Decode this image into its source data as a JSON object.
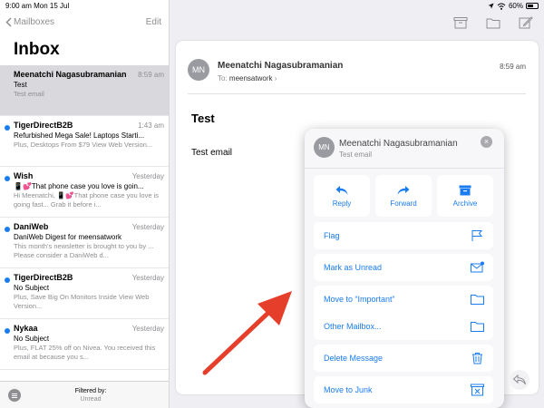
{
  "status": {
    "time_date": "9:00 am  Mon 15 Jul",
    "battery": "60%"
  },
  "nav": {
    "back_label": "Mailboxes",
    "edit_label": "Edit"
  },
  "inbox": {
    "title": "Inbox"
  },
  "mails": [
    {
      "sender": "Meenatchi Nagasubramanian",
      "time": "8:59 am",
      "subject": "Test",
      "preview": "Test email",
      "unread": false,
      "selected": true
    },
    {
      "sender": "TigerDirectB2B",
      "time": "1:43 am",
      "subject": "Refurbished Mega Sale! Laptops Starti...",
      "preview": "Plus, Desktops From $79 View Web Version...",
      "unread": true,
      "selected": false
    },
    {
      "sender": "Wish",
      "time": "Yesterday",
      "subject": "📱💕That phone case you love is goin...",
      "preview": "Hi Meenatchi, 📱💕That phone case you love is going fast... Grab it before i...",
      "unread": true,
      "selected": false
    },
    {
      "sender": "DaniWeb",
      "time": "Yesterday",
      "subject": "DaniWeb Digest for meensatwork",
      "preview": "This month's newsletter is brought to you by ... Please consider a DaniWeb d...",
      "unread": true,
      "selected": false
    },
    {
      "sender": "TigerDirectB2B",
      "time": "Yesterday",
      "subject": "No Subject",
      "preview": "Plus, Save Big On Monitors Inside View Web Version...",
      "unread": true,
      "selected": false
    },
    {
      "sender": "Nykaa",
      "time": "Yesterday",
      "subject": "No Subject",
      "preview": "Plus, FLAT 25% off on Nivea. You received this email at because you s...",
      "unread": true,
      "selected": false
    }
  ],
  "filter": {
    "line1": "Filtered by:",
    "line2": "Unread"
  },
  "message": {
    "avatar": "MN",
    "from": "Meenatchi Nagasubramanian",
    "to_label": "To:",
    "to": "meensatwork",
    "time": "8:59 am",
    "subject": "Test",
    "body": "Test email"
  },
  "popover": {
    "avatar": "MN",
    "name": "Meenatchi Nagasubramanian",
    "subject": "Test email",
    "buttons": {
      "reply": "Reply",
      "forward": "Forward",
      "archive": "Archive"
    },
    "actions": {
      "flag": "Flag",
      "mark_unread": "Mark as Unread",
      "move_important": "Move to “Important”",
      "other_mailbox": "Other Mailbox...",
      "delete": "Delete Message",
      "junk": "Move to Junk"
    }
  },
  "colors": {
    "accent": "#1a7cf2",
    "arrow": "#e53e2b",
    "unread_dot": "#1a7cf2"
  }
}
